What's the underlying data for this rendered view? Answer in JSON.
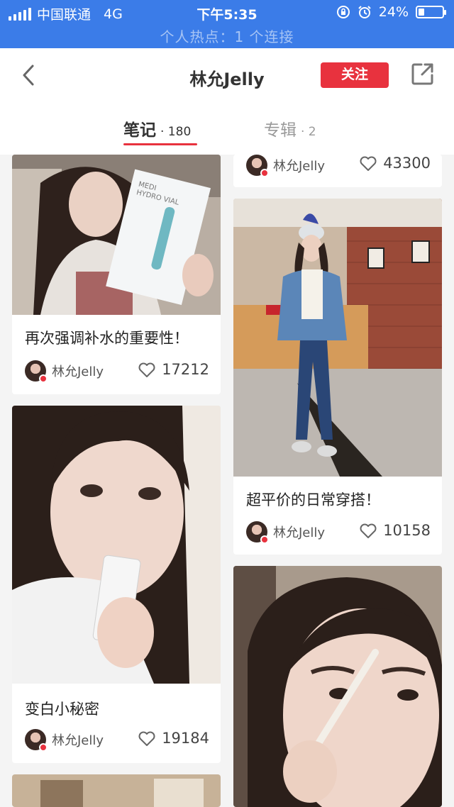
{
  "status_bar": {
    "carrier": "中国联通",
    "network": "4G",
    "time": "下午5:35",
    "battery": "24%",
    "battery_level": 0.24,
    "hotspot": "个人热点：1 个连接"
  },
  "nav": {
    "title": "林允Jelly",
    "follow_label": "关注"
  },
  "tabs": [
    {
      "label": "笔记",
      "count": "· 180"
    },
    {
      "label": "专辑",
      "count": "· 2"
    }
  ],
  "author_name": "林允Jelly",
  "notes": [
    {
      "title": "",
      "author": "林允Jelly",
      "likes": "43300",
      "icon": "heart-outline"
    },
    {
      "title": "再次强调补水的重要性！",
      "author": "林允Jelly",
      "likes": "17212",
      "icon": "heart-outline"
    },
    {
      "title": "超平价的日常穿搭！",
      "author": "林允Jelly",
      "likes": "10158",
      "icon": "heart-outline"
    },
    {
      "title": "变白小秘密",
      "author": "林允Jelly",
      "likes": "19184",
      "icon": "heart-outline"
    }
  ],
  "colors": {
    "status_bar": "#3b7ce8",
    "accent": "#e8323e",
    "background": "#f4f4f4"
  }
}
